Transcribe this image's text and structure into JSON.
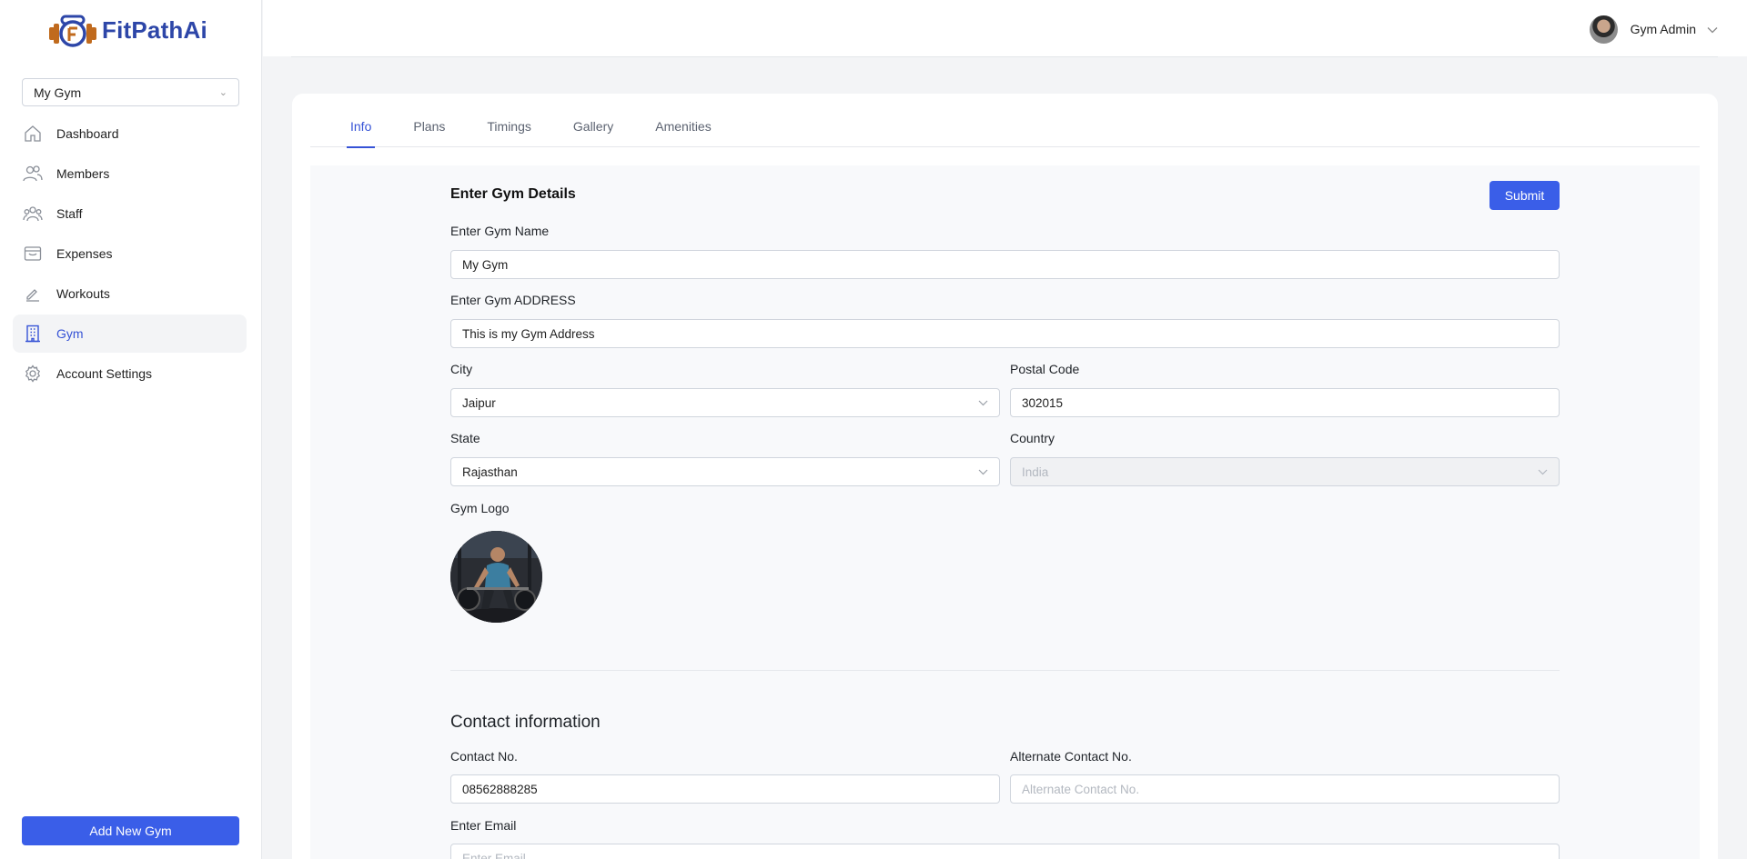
{
  "app": {
    "name": "FitPathAi",
    "brand_color": "#2d46a8",
    "accent": "#3a5ee8"
  },
  "sidebar": {
    "gym_selector": "My Gym",
    "items": [
      {
        "label": "Dashboard",
        "icon": "home-icon"
      },
      {
        "label": "Members",
        "icon": "users-icon"
      },
      {
        "label": "Staff",
        "icon": "staff-icon"
      },
      {
        "label": "Expenses",
        "icon": "wallet-icon"
      },
      {
        "label": "Workouts",
        "icon": "pencil-icon"
      },
      {
        "label": "Gym",
        "icon": "building-icon",
        "active": true
      },
      {
        "label": "Account Settings",
        "icon": "gear-icon"
      }
    ],
    "add_button": "Add New Gym"
  },
  "header": {
    "user_name": "Gym Admin"
  },
  "tabs": [
    "Info",
    "Plans",
    "Timings",
    "Gallery",
    "Amenities"
  ],
  "form": {
    "title": "Enter Gym Details",
    "submit_label": "Submit",
    "gym_name": {
      "label": "Enter Gym Name",
      "value": "My Gym"
    },
    "address": {
      "label": "Enter Gym ADDRESS",
      "value": "This is my Gym Address"
    },
    "city": {
      "label": "City",
      "value": "Jaipur"
    },
    "postal_code": {
      "label": "Postal Code",
      "value": "302015"
    },
    "state": {
      "label": "State",
      "value": "Rajasthan"
    },
    "country": {
      "label": "Country",
      "value": "India"
    },
    "logo": {
      "label": "Gym Logo"
    }
  },
  "contact": {
    "title": "Contact information",
    "contact_no": {
      "label": "Contact No.",
      "value": "08562888285"
    },
    "alt_contact_no": {
      "label": "Alternate Contact No.",
      "placeholder": "Alternate Contact No."
    },
    "email": {
      "label": "Enter Email",
      "placeholder": "Enter Email"
    }
  }
}
